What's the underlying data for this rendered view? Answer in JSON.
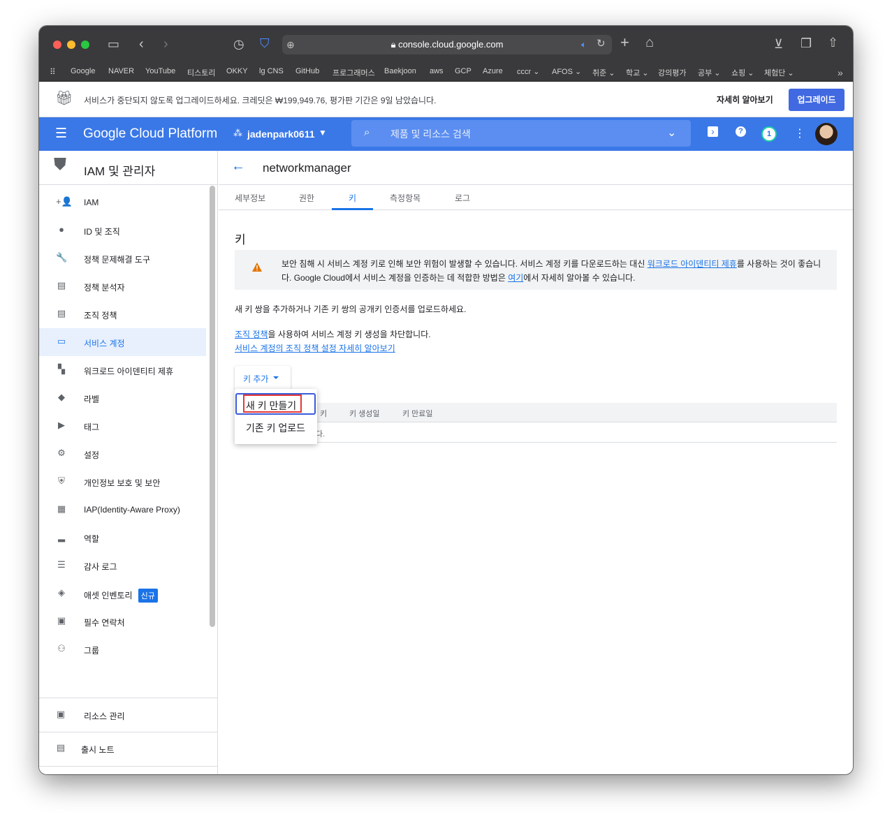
{
  "browser": {
    "url": "console.cloud.google.com",
    "bookmarks": [
      "Google",
      "NAVER",
      "YouTube",
      "티스토리",
      "OKKY",
      "lg CNS",
      "GitHub",
      "프로그래머스",
      "Baekjoon",
      "aws",
      "GCP",
      "Azure",
      "cccr ⌄",
      "AFOS ⌄",
      "취준 ⌄",
      "학교 ⌄",
      "강의평가",
      "공부 ⌄",
      "쇼핑 ⌄",
      "체험단 ⌄"
    ]
  },
  "banner": {
    "text": "서비스가 중단되지 않도록 업그레이드하세요. 크레딧은 ₩199,949.76, 평가판 기간은 9일 남았습니다.",
    "learn_more": "자세히 알아보기",
    "upgrade": "업그레이드"
  },
  "header": {
    "title": "Google Cloud Platform",
    "project": "jadenpark0611",
    "search_placeholder": "제품 및 리소스 검색",
    "notification_count": "1"
  },
  "sidebar": {
    "title": "IAM 및 관리자",
    "items": [
      {
        "label": "IAM",
        "icon": "person-add-icon",
        "glyph": "+👤"
      },
      {
        "label": "ID 및 조직",
        "icon": "account-circle-icon",
        "glyph": "●"
      },
      {
        "label": "정책 문제해결 도구",
        "icon": "wrench-icon",
        "glyph": "🔧"
      },
      {
        "label": "정책 분석자",
        "icon": "policy-doc-icon",
        "glyph": "▤"
      },
      {
        "label": "조직 정책",
        "icon": "list-doc-icon",
        "glyph": "▤"
      },
      {
        "label": "서비스 계정",
        "icon": "service-account-icon",
        "glyph": "▭"
      },
      {
        "label": "워크로드 아이덴티티 제휴",
        "icon": "workload-icon",
        "glyph": "▚"
      },
      {
        "label": "라벨",
        "icon": "label-icon",
        "glyph": "◆"
      },
      {
        "label": "태그",
        "icon": "tag-icon",
        "glyph": "▶"
      },
      {
        "label": "설정",
        "icon": "gear-icon",
        "glyph": "⚙"
      },
      {
        "label": "개인정보 보호 및 보안",
        "icon": "shield-icon",
        "glyph": "⛨"
      },
      {
        "label": "IAP(Identity-Aware Proxy)",
        "icon": "iap-icon",
        "glyph": "▦"
      },
      {
        "label": "역할",
        "icon": "hat-icon",
        "glyph": "▂"
      },
      {
        "label": "감사 로그",
        "icon": "list-icon",
        "glyph": "☰"
      },
      {
        "label": "애셋 인벤토리",
        "icon": "inventory-icon",
        "glyph": "◈",
        "badge": "신규"
      },
      {
        "label": "필수 연락처",
        "icon": "contact-icon",
        "glyph": "▣"
      },
      {
        "label": "그룹",
        "icon": "group-icon",
        "glyph": "⚇"
      }
    ],
    "resource_mgmt": "리소스 관리",
    "release_notes": "출시 노트",
    "collapse": "<|"
  },
  "main": {
    "title": "networkmanager",
    "tabs": [
      "세부정보",
      "권한",
      "키",
      "측정항목",
      "로그"
    ],
    "section_title": "키",
    "warning": {
      "part1": "보안 침해 시 서비스 계정 키로 인해 보안 위험이 발생할 수 있습니다. 서비스 계정 키를 다운로드하는 대신 ",
      "link1": "워크로드 아이덴티티 제휴",
      "part2": "를 사용하는 것이 좋습니다. Google Cloud에서 서비스 계정을 인증하는 데 적합한 방법은 ",
      "link2": "여기",
      "part3": "에서 자세히 알아볼 수 있습니다."
    },
    "intro": "새 키 쌍을 추가하거나 기존 키 쌍의 공개키 인증서를 업로드하세요.",
    "org_policy_link": "조직 정책",
    "org_policy_text": "을 사용하여 서비스 계정 키 생성을 차단합니다.",
    "learn_org_link": "서비스 계정의 조직 정책 설정 자세히 알아보기",
    "add_key": "키 추가",
    "table_headers": [
      "키",
      "키 생성일",
      "키 만료일"
    ],
    "table_empty": "다.",
    "menu": [
      "새 키 만들기",
      "기존 키 업로드"
    ]
  }
}
